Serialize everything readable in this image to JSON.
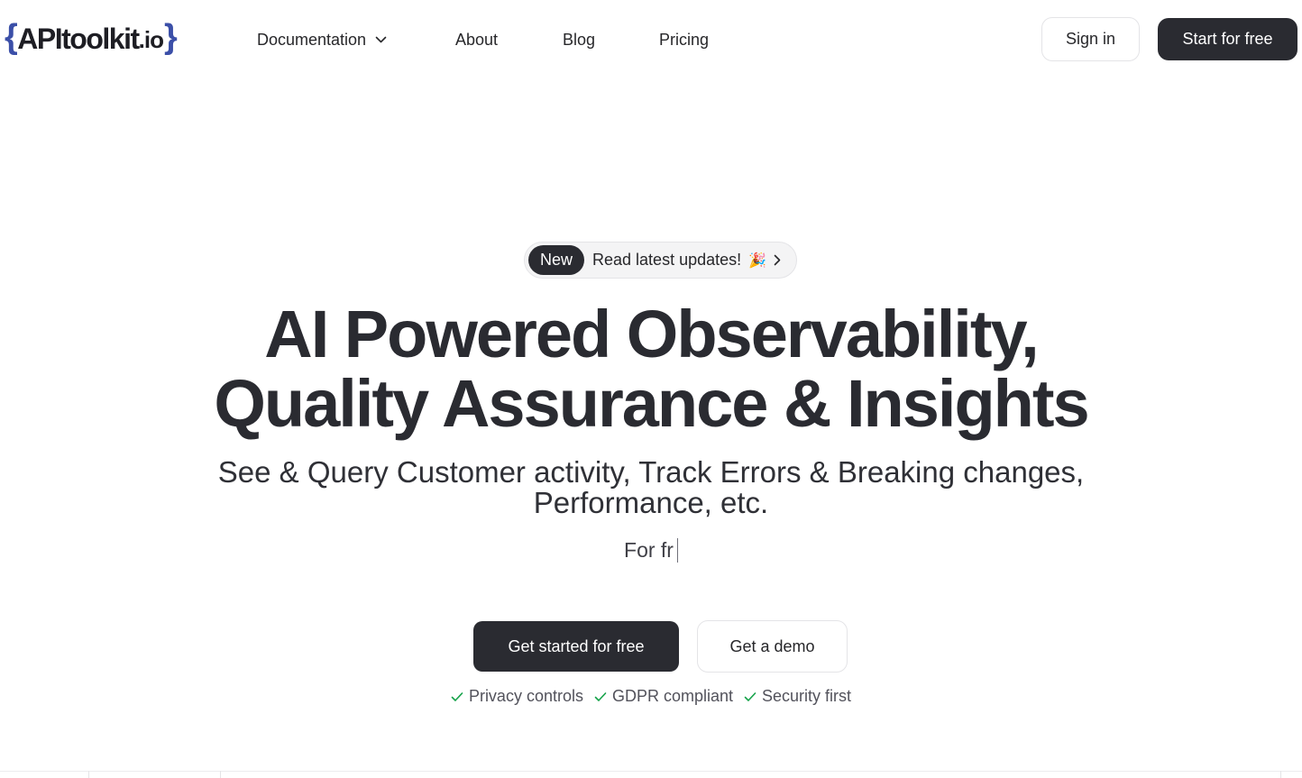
{
  "header": {
    "logo": {
      "brace_left": "{",
      "name": "APItoolkit",
      "suffix": ".io",
      "brace_right": "}",
      "brace_color": "#3b4fa8"
    },
    "nav": [
      {
        "label": "Documentation",
        "has_dropdown": true
      },
      {
        "label": "About"
      },
      {
        "label": "Blog"
      },
      {
        "label": "Pricing"
      }
    ],
    "sign_in_label": "Sign in",
    "start_label": "Start for free"
  },
  "hero": {
    "pill": {
      "badge": "New",
      "text": "Read latest updates!",
      "emoji": "🎉"
    },
    "headline_line1": "AI Powered Observability,",
    "headline_line2": "Quality Assurance & Insights",
    "subhead_line1": "See & Query Customer activity, Track Errors & Breaking changes,",
    "subhead_line2": "Performance, etc.",
    "typing_text": "For fr",
    "primary_cta": "Get started for free",
    "secondary_cta": "Get a demo",
    "features": [
      "Privacy controls",
      "GDPR compliant",
      "Security first"
    ]
  },
  "colors": {
    "dark": "#2a2b31",
    "check": "#16a34a",
    "border": "#e4e4e7"
  }
}
